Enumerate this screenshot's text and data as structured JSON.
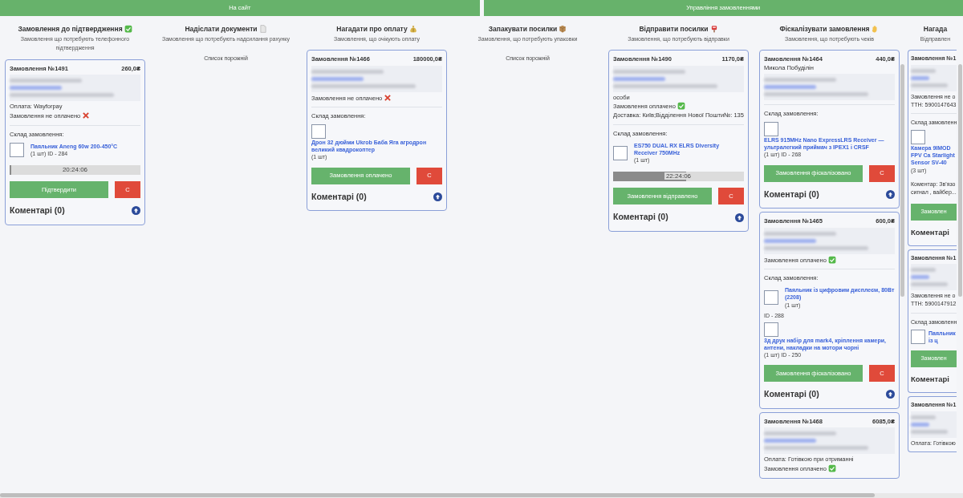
{
  "top_buttons": [
    {
      "label": "На сайт"
    },
    {
      "label": "Управління замовленнями"
    }
  ],
  "columns": [
    {
      "title": "Замовлення до підтвердження",
      "subtitle": "Замовлення що потребують телефонного підтвердження",
      "orders": [
        {
          "title": "Замовлення №1491",
          "total": "260,0₴",
          "payment": "Оплата: Wayforpay",
          "status": "Замовлення не оплачено",
          "paid": false,
          "contents_label": "Склад замовлення:",
          "items": [
            {
              "kind": "inline",
              "name": "Паяльник Aneng 60w 200-450°C",
              "details": "(1 шт) ID - 284"
            }
          ],
          "timer": {
            "text": "20:24:06",
            "level": 0.01
          },
          "actions": [
            {
              "kind": "confirm",
              "label": "Підтвердити"
            },
            {
              "kind": "cancel",
              "label": "С"
            }
          ],
          "comments": "Коментарі (0)",
          "upload_button": true
        }
      ]
    },
    {
      "title": "Надіслати документи",
      "subtitle": "Замовлення що потребують надсилання рахунку",
      "empty_text": "Список порожній"
    },
    {
      "title": "Нагадати про оплату",
      "subtitle": "Замовлення, що очікують оплату",
      "orders": [
        {
          "title": "Замовлення №1466",
          "total": "180000,0₴",
          "status": "Замовлення не оплачено",
          "paid": false,
          "contents_label": "Склад замовлення:",
          "items": [
            {
              "kind": "stacked",
              "name": "Дрон 32 дюйми Ukrob Баба Яга агродрон великий квадрокоптер",
              "details": "(1 шт)"
            }
          ],
          "actions": [
            {
              "kind": "confirm",
              "label": "Замовлення оплачено"
            },
            {
              "kind": "cancel",
              "label": "С"
            }
          ],
          "comments": "Коментарі (0)",
          "upload_button": true
        }
      ]
    },
    {
      "title": "Запакувати посилки",
      "subtitle": "Замовлення, що потребують упаковки",
      "empty_text": "Список порожній"
    },
    {
      "title": "Відправити посилки",
      "subtitle": "Замовлення, що потребують відправки",
      "orders": [
        {
          "title": "Замовлення №1490",
          "total": "1170,0₴",
          "note": "особи",
          "status": "Замовлення оплачено",
          "paid": true,
          "delivery": "Доставка: Київ;Відділення Нової Пошти№: 135",
          "contents_label": "Склад замовлення:",
          "items": [
            {
              "kind": "inline",
              "name": "ES750 DUAL RX ELRS Diversity Receiver 750MHz",
              "details": "(1 шт)"
            }
          ],
          "timer": {
            "text": "22:24:06",
            "level": 0.56
          },
          "actions": [
            {
              "kind": "confirm",
              "label": "Замовлення відправлено"
            },
            {
              "kind": "cancel",
              "label": "С"
            }
          ],
          "comments": "Коментарі (0)",
          "upload_button": true
        }
      ]
    },
    {
      "title": "Фіскалізувати замовлення",
      "subtitle": "Замовлення, що потребують чеків",
      "scrollbar": true,
      "orders": [
        {
          "title": "Замовлення №1464",
          "total": "440,0₴",
          "name": "Микола Побуділін",
          "contents_label": "Склад замовлення:",
          "items": [
            {
              "kind": "stacked",
              "name": "ELRS 915MHz Nano ExpressLRS Receiver — ультралегкий приймач з IPEX1 і CRSF",
              "details": "(1 шт) ID - 268"
            }
          ],
          "actions": [
            {
              "kind": "confirm",
              "label": "Замовлення фіскалізовано"
            },
            {
              "kind": "cancel",
              "label": "С"
            }
          ],
          "comments": "Коментарі (0)",
          "upload_button": true
        },
        {
          "title": "Замовлення №1465",
          "total": "600,0₴",
          "status": "Замовлення оплачено",
          "paid": true,
          "contents_label": "Склад замовлення:",
          "items": [
            {
              "kind": "inline",
              "name": "Паяльник із цифровим дисплеєм, 80Вт (2208)",
              "details": "(1 шт)",
              "id": "ID - 288"
            },
            {
              "kind": "stacked",
              "name": "3д друк набір для mark4, кріплення камери, антени, накладки на мотори чорні",
              "details": "(1 шт) ID - 250"
            }
          ],
          "actions": [
            {
              "kind": "confirm",
              "label": "Замовлення фіскалізовано"
            },
            {
              "kind": "cancel",
              "label": "С"
            }
          ],
          "comments": "Коментарі (0)",
          "upload_button": true
        },
        {
          "title": "Замовлення №1468",
          "total": "6085,0₴",
          "payment": "Оплата: Готівкою при отриманні",
          "status": "Замовлення оплачено",
          "paid": true
        }
      ]
    },
    {
      "title": "Нагада",
      "subtitle": "Відправлен",
      "scrollbar": true,
      "orders": [
        {
          "title": "Замовлення №1",
          "status": "Замовлення не о",
          "delivery": "ТТН: 5900147643",
          "contents_label": "Склад замовленн",
          "items": [
            {
              "kind": "stacked",
              "name": "Камера 9IMOD FPV Ca Starlight Sensor SV-40",
              "details": "(3 шт)"
            }
          ],
          "comment": "Коментар: Зв'язо сигнал , вайбер...",
          "actions": [
            {
              "kind": "confirm",
              "label": "Замовлен"
            }
          ],
          "comments": "Коментарі"
        },
        {
          "title": "Замовлення №1",
          "status": "Замовлення не о",
          "delivery": "ТТН: 5900147912",
          "contents_label": "Склад замовленн",
          "items": [
            {
              "kind": "inline",
              "name": "Паяльник із ц"
            }
          ],
          "actions": [
            {
              "kind": "confirm",
              "label": "Замовлен"
            }
          ],
          "comments": "Коментарі"
        },
        {
          "title": "Замовлення №1",
          "payment": "Оплата: Готівкою"
        }
      ]
    }
  ]
}
